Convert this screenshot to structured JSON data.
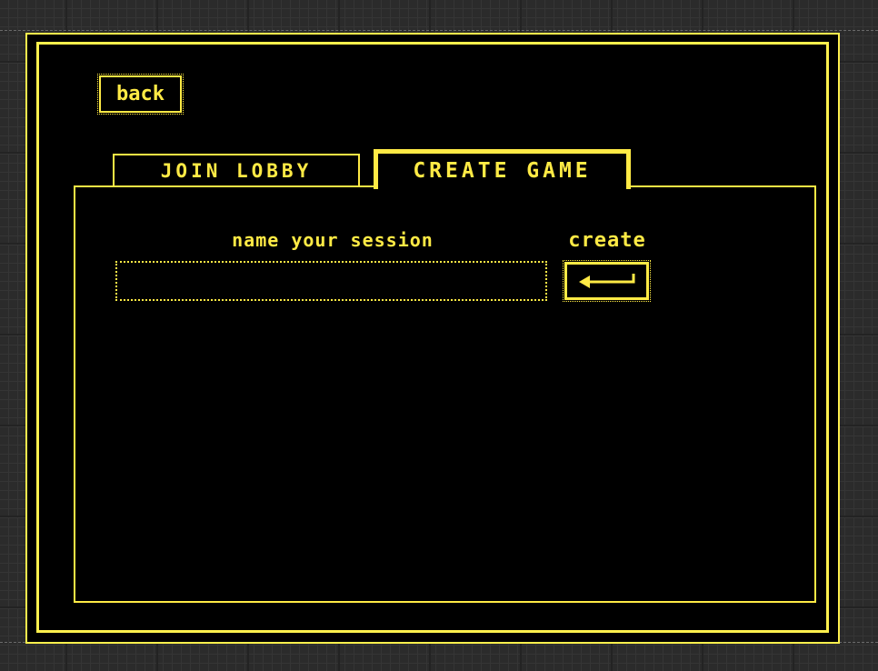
{
  "back": {
    "label": "back"
  },
  "tabs": [
    {
      "label": "JOIN LOBBY",
      "active": false
    },
    {
      "label": "CREATE GAME",
      "active": true
    }
  ],
  "create_game": {
    "session_label": "name your session",
    "session_input": {
      "value": "",
      "placeholder": ""
    },
    "create_label": "create",
    "submit_icon": "enter-arrow-icon"
  },
  "colors": {
    "accent": "#ffea45",
    "background": "#000000"
  }
}
